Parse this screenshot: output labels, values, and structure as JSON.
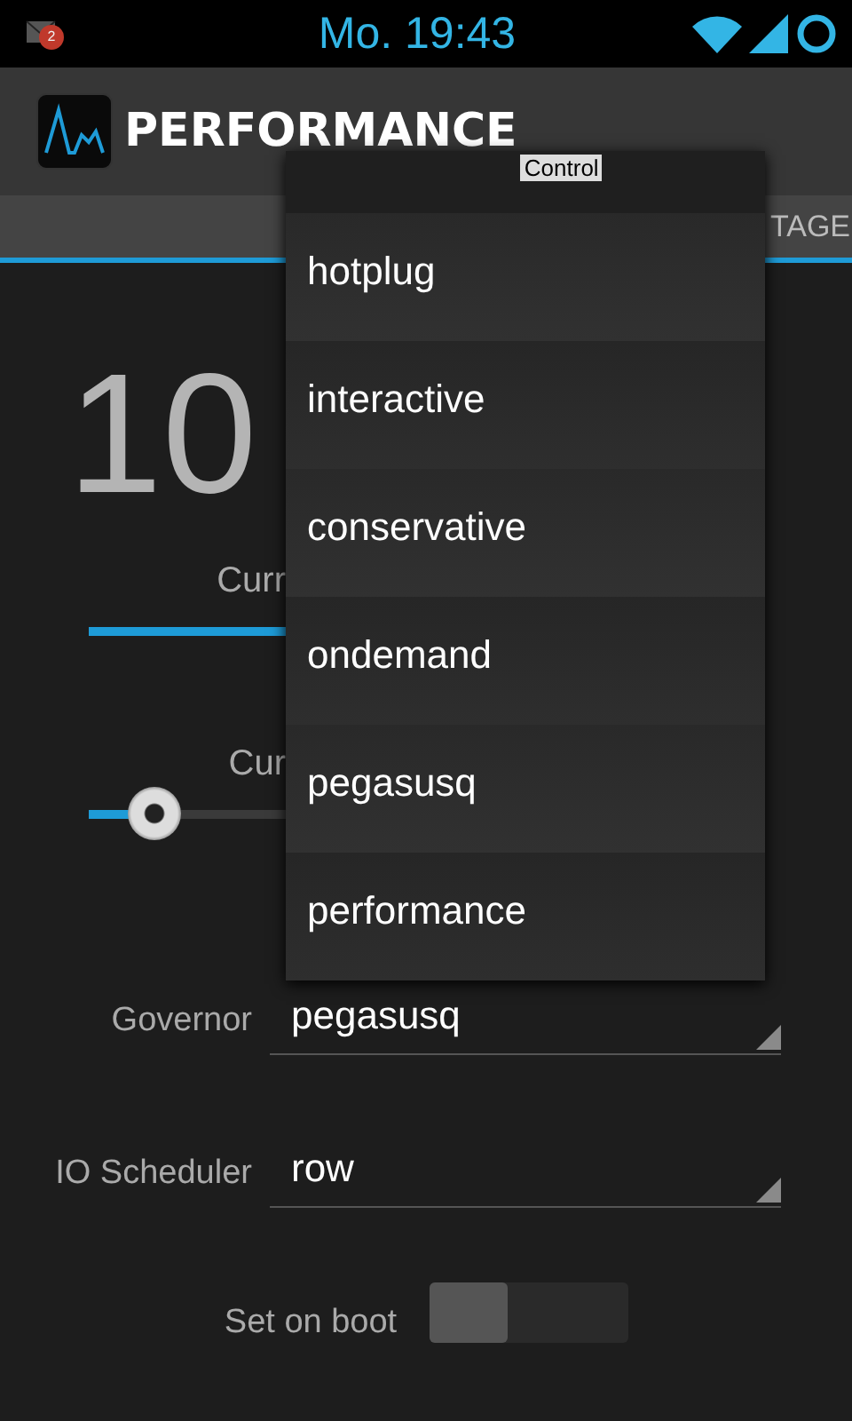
{
  "status_bar": {
    "time": "Mo. 19:43",
    "notification_badge": "2"
  },
  "action_bar": {
    "title": "PERFORMANCE",
    "subtitle": "Control"
  },
  "tabs": [
    {
      "label": "TAGE",
      "selected": false
    }
  ],
  "frequency": {
    "left_part": "10"
  },
  "sliders": [
    {
      "label": "Curr",
      "level": 1.0
    },
    {
      "label": "Cur",
      "level": 0.1
    }
  ],
  "dropdown": {
    "options": [
      {
        "label": "hotplug",
        "selected": false
      },
      {
        "label": "interactive",
        "selected": false
      },
      {
        "label": "conservative",
        "selected": false
      },
      {
        "label": "ondemand",
        "selected": false
      },
      {
        "label": "pegasusq",
        "selected": false
      },
      {
        "label": "performance",
        "selected": false
      }
    ]
  },
  "settings": [
    {
      "kind": "spinner",
      "label": "Governor",
      "value": "pegasusq"
    },
    {
      "kind": "spinner",
      "label": "IO Scheduler",
      "value": "row"
    },
    {
      "kind": "switch",
      "label": "Set on boot",
      "on": false
    }
  ]
}
